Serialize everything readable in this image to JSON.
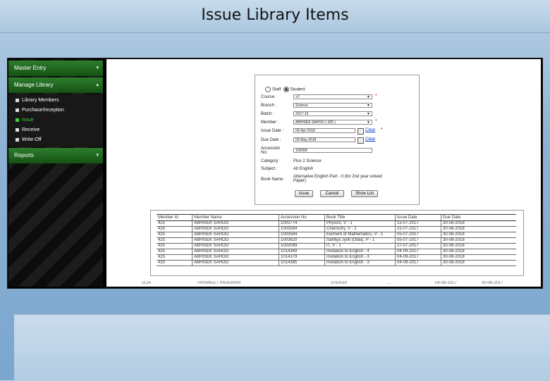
{
  "slide": {
    "title": "Issue Library Items"
  },
  "sidebar": {
    "menus": [
      {
        "label": "Master Entry",
        "chevron": "▾"
      },
      {
        "label": "Manage Library",
        "chevron": "▴"
      },
      {
        "label": "Reports",
        "chevron": "▾"
      }
    ],
    "submenu": [
      {
        "label": "Library Members"
      },
      {
        "label": "Purchase/Inception"
      },
      {
        "label": "Issue"
      },
      {
        "label": "Receive"
      },
      {
        "label": "Write-Off"
      }
    ]
  },
  "form": {
    "radio_staff": "Staff",
    "radio_student": "Student",
    "course": {
      "label": "Course :",
      "value": "+2"
    },
    "branch": {
      "label": "Branch :",
      "value": "Science"
    },
    "batch": {
      "label": "Batch :",
      "value": "2017-19"
    },
    "member": {
      "label": "Member :",
      "value": "ABHISEK SAHOO ( 425 )"
    },
    "issue_date": {
      "label": "Issue Date :",
      "value": "03-Apr-2018",
      "clear": "Clear"
    },
    "due_date": {
      "label": "Due Date :",
      "value": "03-May-2018",
      "clear": "Clear"
    },
    "accession": {
      "label_1": "Accession",
      "label_2": "No:",
      "value": "100008"
    },
    "category": {
      "label": "Category :",
      "value": "Plus 2 Science"
    },
    "subject": {
      "label": "Subject :",
      "value": "Alt English"
    },
    "book_name": {
      "label": "Book Name :",
      "value_1": "Alternative English Part - II (for 2nd year solved",
      "value_2": "Paper)"
    },
    "buttons": {
      "issue": "Issue",
      "cancel": "Cancel",
      "show_list": "Show List"
    }
  },
  "table": {
    "headers": [
      "Member Id",
      "Member Name",
      "Accession No",
      "Book Title",
      "Issue Date",
      "Due Date"
    ],
    "rows": [
      [
        "425",
        "ABHISEK SAHOO",
        "1003774",
        "Physics, V - 1",
        "15-07-2017",
        "30-08-2018"
      ],
      [
        "425",
        "ABHISEK SAHOO",
        "1003584",
        "Chemistry, V - 1",
        "15-07-2017",
        "30-08-2018"
      ],
      [
        "425",
        "ABHISEK SAHOO",
        "1003594",
        "Element of Mathematics, V - 1",
        "05-07-2017",
        "30-08-2018"
      ],
      [
        "425",
        "ABHISEK SAHOO",
        "1003620",
        "Sahitya Jyoti (Odia), P - 1",
        "05-07-2017",
        "30-08-2018"
      ],
      [
        "425",
        "ABHISEK SAHOO",
        "1003099",
        "IT, V - 1",
        "27-07-2017",
        "30-08-2018"
      ],
      [
        "425",
        "ABHISEK SAHOO",
        "1014349",
        "Invitation to English - 4",
        "04-09-2017",
        "30-08-2018"
      ],
      [
        "425",
        "ABHISEK SAHOO",
        "1014379",
        "Invitation to English - 3",
        "04-09-2017",
        "30-08-2018"
      ],
      [
        "425",
        "ABHISEK SAHOO",
        "1014385",
        "Invitation to English - 3",
        "04-09-2017",
        "30-08-2018"
      ]
    ],
    "peek": [
      "1124",
      "TRISWEET PRADHAN",
      "1014310",
      "...",
      "04-08-2017",
      "30-08-2017"
    ]
  }
}
